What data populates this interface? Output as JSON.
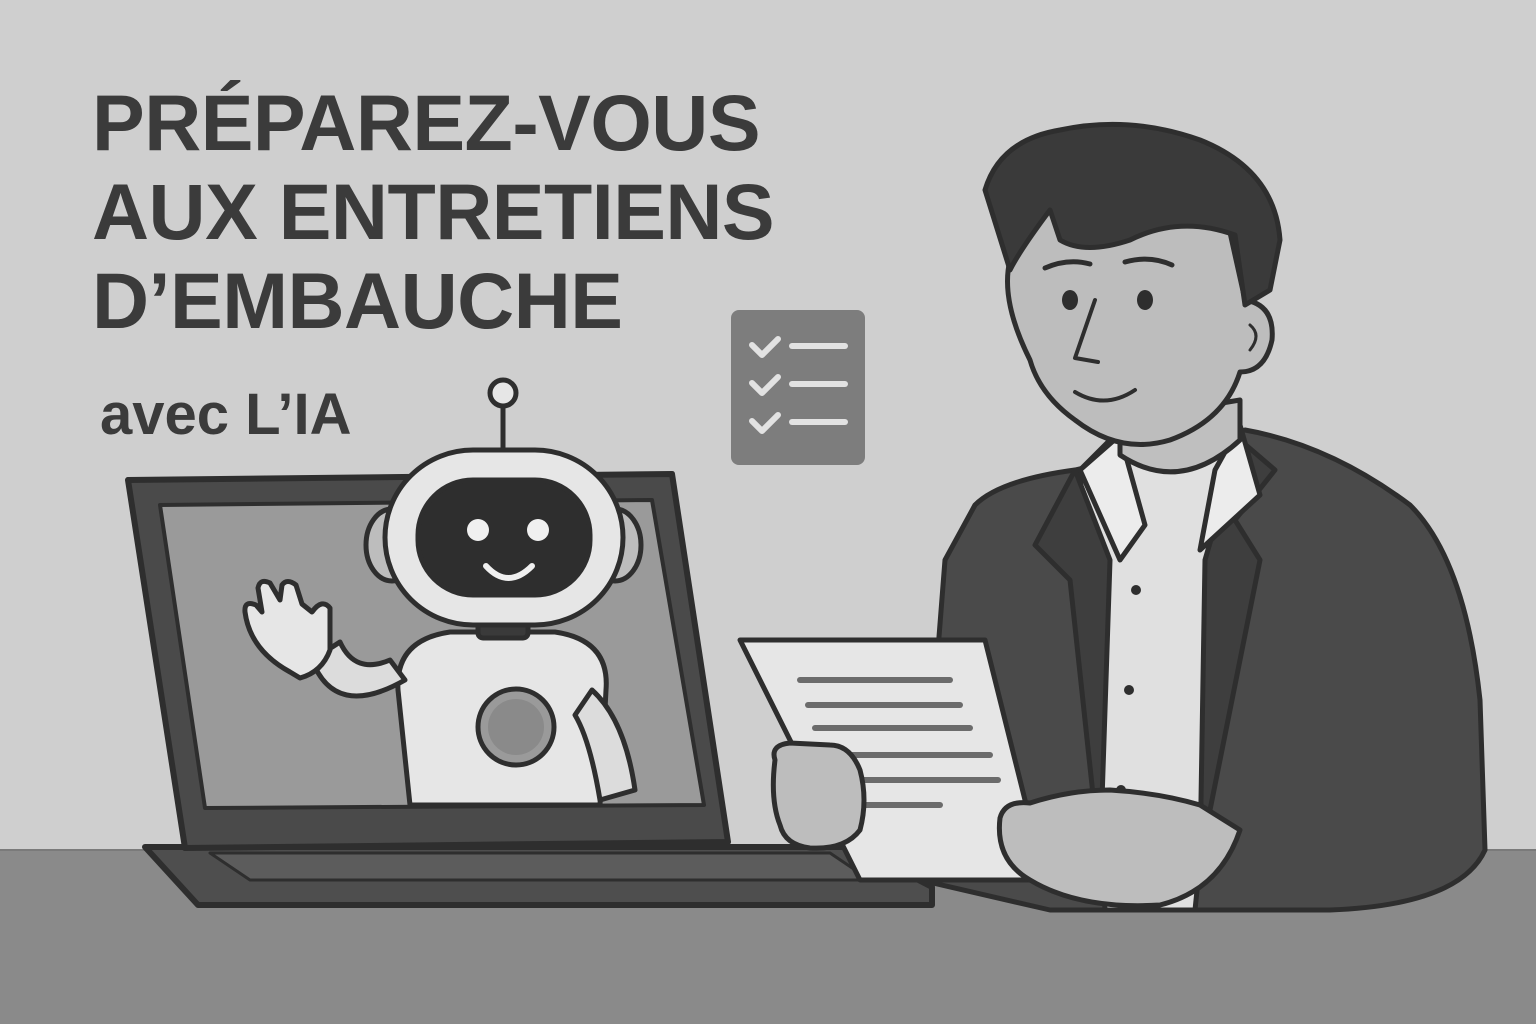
{
  "headline": {
    "line1": "PRÉPAREZ-VOUS",
    "line2": "AUX ENTRETIENS",
    "line3": "D’EMBAUCHE"
  },
  "subline": "avec L’IA",
  "illustration": {
    "elements": [
      "laptop",
      "robot-waving",
      "checklist-icon",
      "man-in-suit",
      "document"
    ],
    "checklist_items": 3
  },
  "colors": {
    "background": "#cfcfcf",
    "desk": "#8a8a8a",
    "text": "#3b3b3b",
    "outline": "#2e2e2e"
  }
}
